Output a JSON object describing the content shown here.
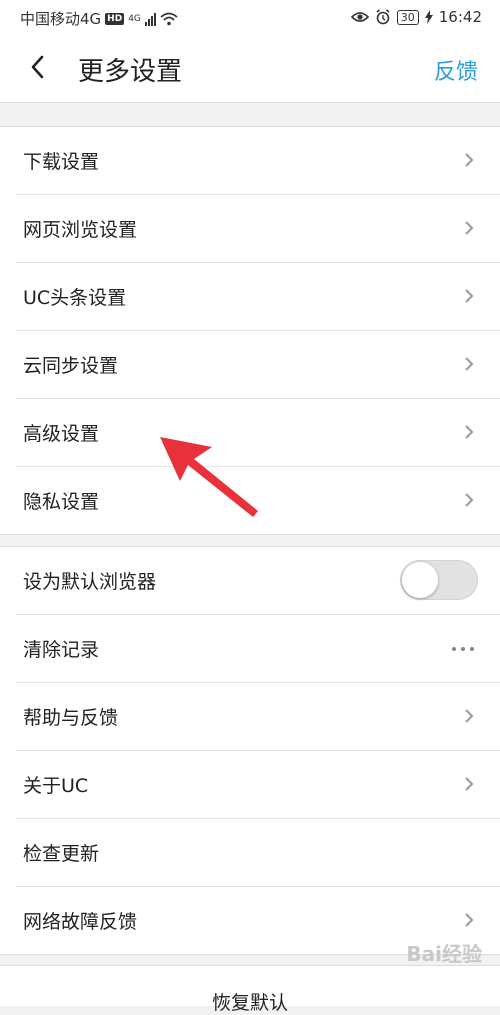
{
  "status_bar": {
    "carrier": "中国移动4G",
    "hd": "HD",
    "net": "4G",
    "battery": "30",
    "time": "16:42"
  },
  "header": {
    "title": "更多设置",
    "feedback": "反馈"
  },
  "group1": {
    "items": [
      {
        "label": "下载设置"
      },
      {
        "label": "网页浏览设置"
      },
      {
        "label": "UC头条设置"
      },
      {
        "label": "云同步设置"
      },
      {
        "label": "高级设置"
      },
      {
        "label": "隐私设置"
      }
    ]
  },
  "group2": {
    "items": [
      {
        "label": "设为默认浏览器",
        "control": "toggle",
        "state": "off"
      },
      {
        "label": "清除记录",
        "control": "more"
      },
      {
        "label": "帮助与反馈",
        "control": "chevron"
      },
      {
        "label": "关于UC",
        "control": "chevron"
      },
      {
        "label": "检查更新",
        "control": "none"
      },
      {
        "label": "网络故障反馈",
        "control": "chevron"
      }
    ]
  },
  "footer": {
    "restore_label": "恢复默认"
  },
  "watermark": "Bai经验",
  "colors": {
    "accent": "#2a9ddf",
    "annotation_arrow": "#e8313a"
  }
}
